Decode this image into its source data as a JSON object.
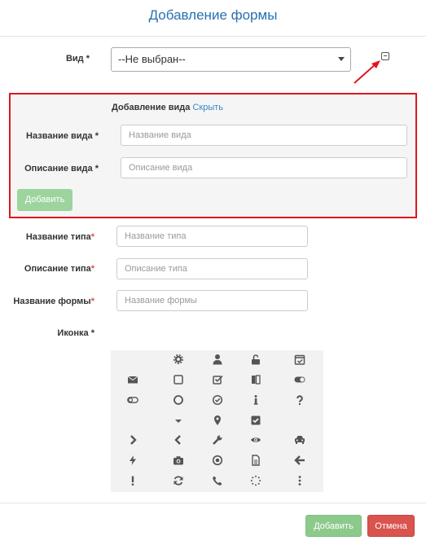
{
  "header": {
    "title": "Добавление формы"
  },
  "kind": {
    "label": "Вид *",
    "selected": "--Не выбран--"
  },
  "add_kind_panel": {
    "heading": "Добавление вида",
    "hide_link": "Скрыть",
    "name_label": "Название вида *",
    "name_placeholder": "Название вида",
    "desc_label": "Описание вида *",
    "desc_placeholder": "Описание вида",
    "add_button": "Добавить"
  },
  "type_name": {
    "label": "Название типа",
    "star": "*",
    "placeholder": "Название типа"
  },
  "type_desc": {
    "label": "Описание типа",
    "star": "*",
    "placeholder": "Описание типа"
  },
  "form_name": {
    "label": "Название формы",
    "star": "*",
    "placeholder": "Название формы"
  },
  "icon_section": {
    "label": "Иконка *",
    "icons": [
      "gear-icon",
      "user-icon",
      "unlock-icon",
      "calendar-check-icon",
      "envelope-icon",
      "square-icon",
      "check-square-icon",
      "book-icon",
      "toggle-on-icon",
      "toggle-off-icon",
      "circle-icon",
      "check-circle-icon",
      "info-icon",
      "question-icon",
      "caret-down-icon",
      "map-marker-icon",
      "checked-box-icon",
      "chevron-right-icon",
      "chevron-left-icon",
      "wrench-icon",
      "eye-icon",
      "car-icon",
      "bolt-icon",
      "camera-icon",
      "dot-circle-icon",
      "file-icon",
      "arrow-left-icon",
      "exclamation-icon",
      "refresh-icon",
      "phone-icon",
      "spinner-icon",
      "ellipsis-vertical-icon"
    ]
  },
  "footer": {
    "add_button": "Добавить",
    "cancel_button": "Отмена"
  },
  "colors": {
    "accent": "#2a6fb0",
    "highlight": "#e0161e",
    "success": "#8cca8c",
    "danger": "#d9534f"
  }
}
